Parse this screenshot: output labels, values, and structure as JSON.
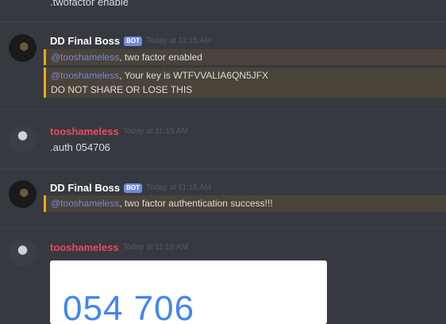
{
  "top_message": {
    "text": ".twofactor enable"
  },
  "message1": {
    "author": "DD Final Boss",
    "badge": "BOT",
    "time": "Today at 11:15 AM",
    "line1_mention": "@tooshameless",
    "line1_text": ", two factor enabled",
    "line2_mention": "@tooshameless",
    "line2_text": ", Your key is WTFVVALIA6QN5JFX",
    "line3_text": "DO NOT SHARE OR LOSE THIS"
  },
  "message2": {
    "author": "tooshameless",
    "time": "Today at 11:15 AM",
    "text": ".auth 054706"
  },
  "message3": {
    "author": "DD Final Boss",
    "badge": "BOT",
    "time": "Today at 11:15 AM",
    "mention": "@tooshameless",
    "text": ", two factor authentication success!!!"
  },
  "message4": {
    "author": "tooshameless",
    "time": "Today at 11:16 AM",
    "image_code": "054 706"
  },
  "colors": {
    "background": "#36393f",
    "mention": "#7289da",
    "highlight_bar": "#faa61a",
    "user_name": "#e84a5f",
    "code_blue": "#4285f4"
  }
}
